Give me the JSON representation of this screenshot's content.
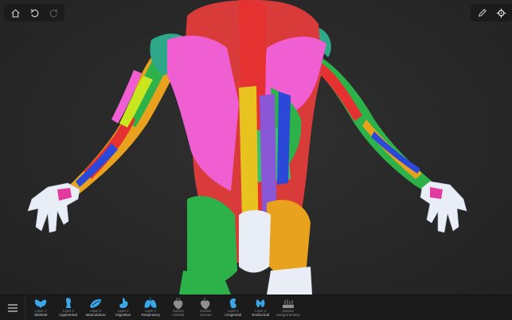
{
  "toolbar_left": {
    "home_icon": "home-icon",
    "undo_icon": "undo-icon",
    "redo_icon": "redo-icon"
  },
  "toolbar_right": {
    "pencil_icon": "pencil-icon",
    "target_icon": "crosshair-icon"
  },
  "bottom_bar": {
    "menu_icon": "hamburger-menu-icon",
    "layers": [
      {
        "caption": "Layer 1",
        "name": "Skeletal",
        "icon": "pelvis-icon",
        "active": true
      },
      {
        "caption": "Layer 2",
        "name": "Ligamental",
        "icon": "ligament-icon",
        "active": true
      },
      {
        "caption": "Layer 6",
        "name": "Musculature",
        "icon": "muscle-icon",
        "active": true
      },
      {
        "caption": "Layer 1",
        "name": "Digestive",
        "icon": "stomach-icon",
        "active": true
      },
      {
        "caption": "Layer 2",
        "name": "Respiratory",
        "icon": "lungs-icon",
        "active": true
      },
      {
        "caption": "inactive",
        "name": "Arterial",
        "icon": "heart-arterial-icon",
        "active": false
      },
      {
        "caption": "inactive",
        "name": "venous",
        "icon": "heart-venous-icon",
        "active": false
      },
      {
        "caption": "Layer 1",
        "name": "Urogenital",
        "icon": "kidney-icon",
        "active": true
      },
      {
        "caption": "Layer 2",
        "name": "Endocrinal",
        "icon": "thyroid-icon",
        "active": true
      },
      {
        "caption": "inactive",
        "name": "Integumentary",
        "icon": "skin-icon",
        "active": false
      }
    ]
  },
  "colors": {
    "accent_blue": "#3aa6e8",
    "background": "#272727",
    "bar": "#1b1b1b"
  }
}
